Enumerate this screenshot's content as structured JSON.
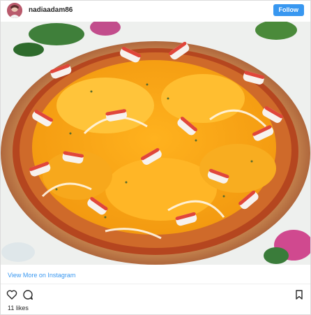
{
  "header": {
    "username": "nadiaadam86",
    "follow_label": "Follow"
  },
  "photo": {
    "subject": "pizza-photo"
  },
  "footer": {
    "view_more_label": "View More on Instagram",
    "likes_text": "11 likes"
  },
  "icons": {
    "like": "heart-icon",
    "comment": "comment-icon",
    "save": "bookmark-icon"
  },
  "colors": {
    "follow_button": "#3897f0",
    "link": "#3897f0",
    "text": "#262626",
    "divider": "#efefef"
  }
}
